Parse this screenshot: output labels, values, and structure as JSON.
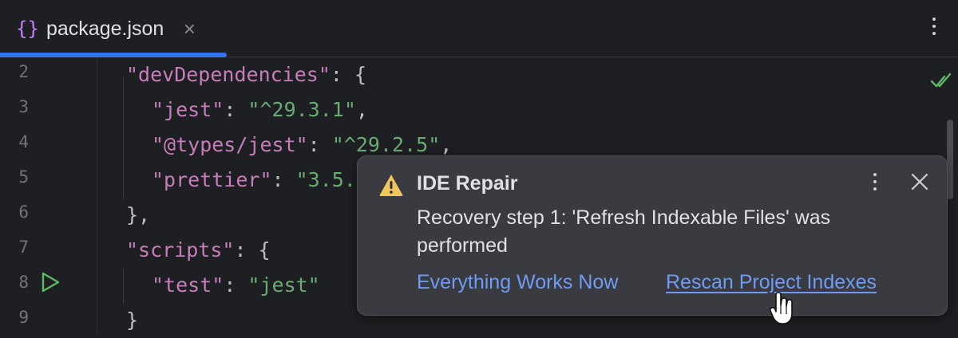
{
  "tab": {
    "icon": "{}",
    "label": "package.json",
    "close": "×"
  },
  "gutter": {
    "lines": [
      "2",
      "3",
      "4",
      "5",
      "6",
      "7",
      "8",
      "9"
    ]
  },
  "code": {
    "line2": {
      "key": "\"devDependencies\"",
      "rest": ": {"
    },
    "line3": {
      "key": "\"jest\"",
      "sep": ": ",
      "val": "\"^29.3.1\"",
      "end": ","
    },
    "line4": {
      "key": "\"@types/jest\"",
      "sep": ": ",
      "val": "\"^29.2.5\"",
      "end": ","
    },
    "line5": {
      "key": "\"prettier\"",
      "sep": ": ",
      "val": "\"3.5."
    },
    "line6": {
      "text": "},"
    },
    "line7": {
      "key": "\"scripts\"",
      "rest": ": {"
    },
    "line8": {
      "key": "\"test\"",
      "sep": ": ",
      "val": "\"jest\""
    },
    "line9": {
      "text": "}"
    }
  },
  "notification": {
    "title": "IDE Repair",
    "body": "Recovery step 1: 'Refresh Indexable Files' was performed",
    "actions": {
      "primary": "Everything Works Now",
      "secondary": "Rescan Project Indexes"
    }
  },
  "colors": {
    "accent": "#3574f0",
    "link": "#6f9bf3",
    "string_key": "#c77dba",
    "string_value": "#6aab73",
    "warning": "#f2c55c",
    "success": "#5fb865"
  },
  "icons": [
    "json-braces-icon",
    "close-icon",
    "more-vertical-icon",
    "run-icon",
    "check-icon",
    "warning-icon",
    "hand-cursor-icon"
  ]
}
